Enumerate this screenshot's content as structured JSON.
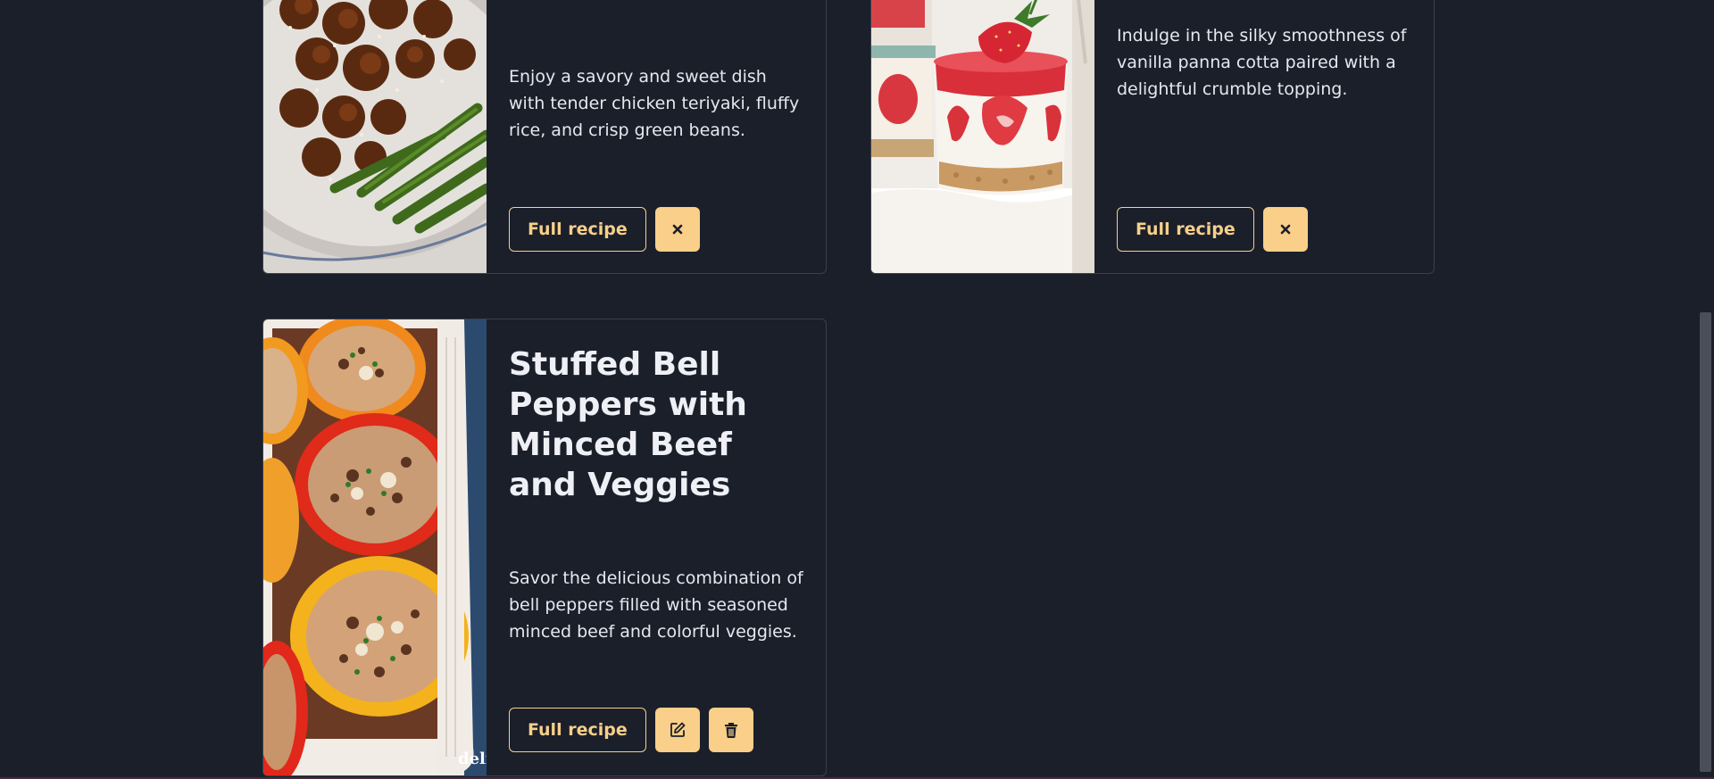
{
  "cards": [
    {
      "title": "",
      "description": "Enjoy a savory and sweet dish with tender chicken teriyaki, fluffy rice, and crisp green beans.",
      "full_recipe_label": "Full recipe",
      "actions": [
        "close-icon"
      ]
    },
    {
      "title": "",
      "description": "Indulge in the silky smoothness of vanilla panna cotta paired with a delightful crumble topping.",
      "full_recipe_label": "Full recipe",
      "actions": [
        "close-icon"
      ]
    },
    {
      "title": "Stuffed Bell Peppers with Minced Beef and Veggies",
      "description": "Savor the delicious combination of bell peppers filled with seasoned minced beef and colorful veggies.",
      "full_recipe_label": "Full recipe",
      "actions": [
        "edit-icon",
        "trash-icon"
      ],
      "watermark": "deli"
    }
  ],
  "colors": {
    "background": "#1b1f2a",
    "accent": "#f9cf89",
    "border": "#3a3f4b"
  }
}
